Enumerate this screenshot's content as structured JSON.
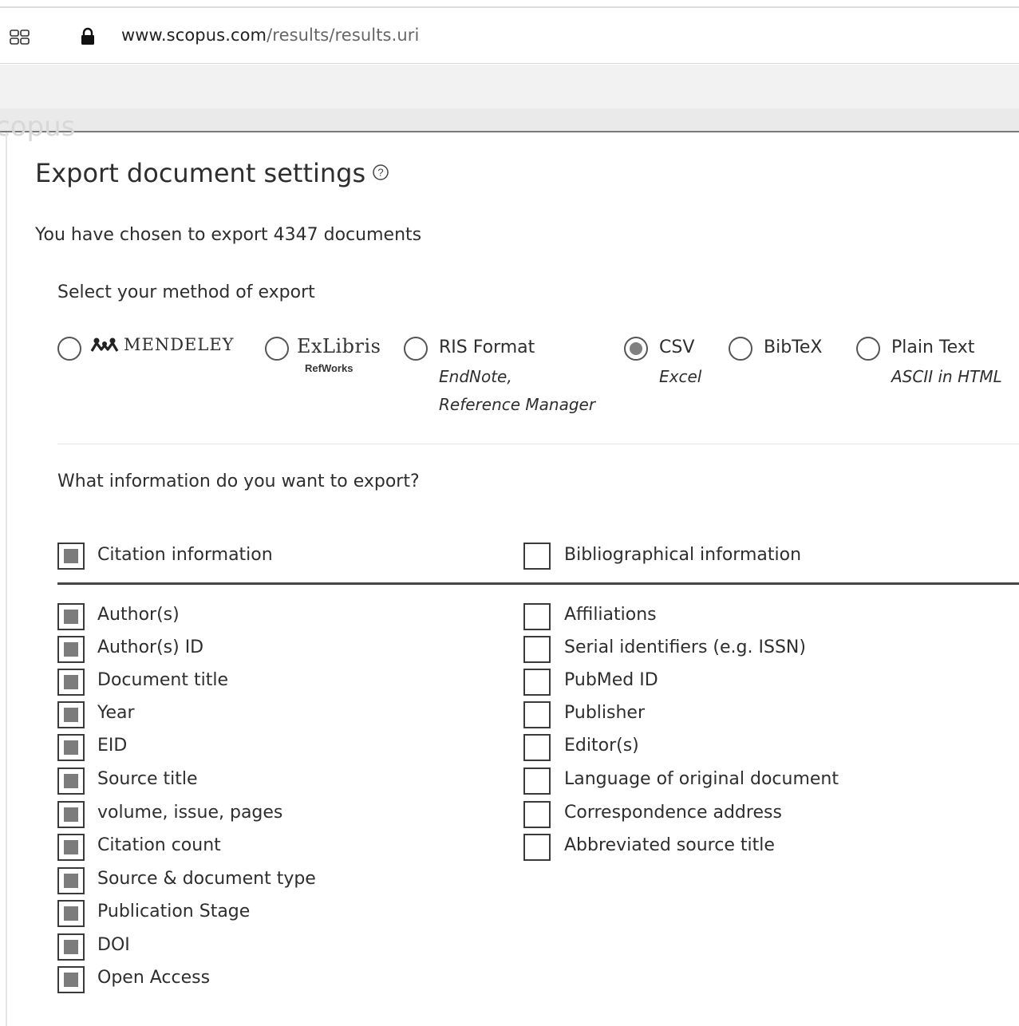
{
  "browser": {
    "url_host": "www.scopus.com",
    "url_path": "/results/results.uri",
    "tabs_icon": "tabs-grid-icon",
    "lock_icon": "lock-icon"
  },
  "background": {
    "ghost_text": "copus"
  },
  "modal": {
    "title": "Export document settings",
    "help_icon": "help-circle-icon",
    "chosen_text": "You have chosen to export 4347 documents",
    "method_label": "Select your method of export",
    "methods": [
      {
        "id": "mendeley",
        "label": "MENDELEY",
        "icon": "mendeley-logo-icon",
        "selected": false
      },
      {
        "id": "refworks",
        "label": "ExLibris",
        "sublabel": "RefWorks",
        "icon": "exlibris-logo-icon",
        "selected": false
      },
      {
        "id": "ris",
        "label": "RIS Format",
        "sub1": "EndNote,",
        "sub2": "Reference Manager",
        "selected": false
      },
      {
        "id": "csv",
        "label": "CSV",
        "sub1": "Excel",
        "selected": true
      },
      {
        "id": "bibtex",
        "label": "BibTeX",
        "selected": false
      },
      {
        "id": "plaintext",
        "label": "Plain Text",
        "sub1": "ASCII in HTML",
        "selected": false
      }
    ],
    "what_label": "What information do you want to export?",
    "groups": [
      {
        "title": "Citation information",
        "checked": true,
        "items": [
          {
            "label": "Author(s)",
            "checked": true
          },
          {
            "label": "Author(s) ID",
            "checked": true
          },
          {
            "label": "Document title",
            "checked": true
          },
          {
            "label": "Year",
            "checked": true
          },
          {
            "label": "EID",
            "checked": true
          },
          {
            "label": "Source title",
            "checked": true
          },
          {
            "label": "volume, issue, pages",
            "checked": true
          },
          {
            "label": "Citation count",
            "checked": true
          },
          {
            "label": "Source & document type",
            "checked": true
          },
          {
            "label": "Publication Stage",
            "checked": true
          },
          {
            "label": "DOI",
            "checked": true
          },
          {
            "label": "Open Access",
            "checked": true
          }
        ]
      },
      {
        "title": "Bibliographical information",
        "checked": false,
        "items": [
          {
            "label": "Affiliations",
            "checked": false
          },
          {
            "label": "Serial identifiers (e.g. ISSN)",
            "checked": false
          },
          {
            "label": "PubMed ID",
            "checked": false
          },
          {
            "label": "Publisher",
            "checked": false
          },
          {
            "label": "Editor(s)",
            "checked": false
          },
          {
            "label": "Language of original document",
            "checked": false
          },
          {
            "label": "Correspondence address",
            "checked": false
          },
          {
            "label": "Abbreviated source title",
            "checked": false
          }
        ]
      }
    ]
  }
}
